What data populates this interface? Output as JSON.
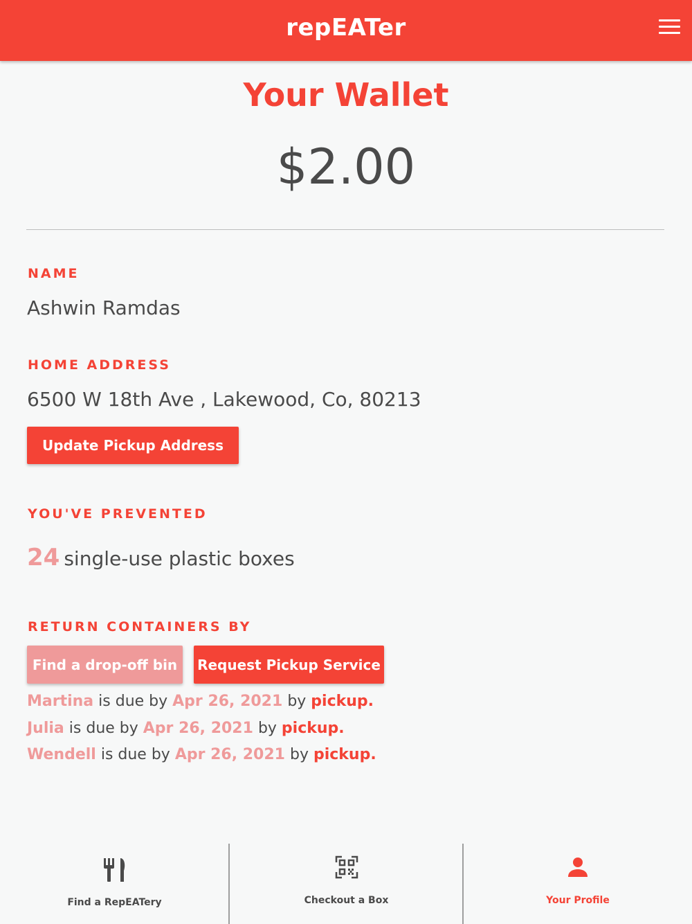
{
  "header": {
    "brand": "repEATer",
    "menu_icon": "hamburger-menu-icon",
    "color": "#f44336"
  },
  "wallet": {
    "title": "Your Wallet",
    "amount": "$2.00"
  },
  "profile": {
    "name_label": "NAME",
    "name": "Ashwin Ramdas",
    "address_label": "HOME ADDRESS",
    "address": "6500 W 18th Ave , Lakewood, Co, 80213",
    "update_button": "Update Pickup Address"
  },
  "prevented": {
    "label": "YOU'VE PREVENTED",
    "count": "24",
    "text": "single-use plastic boxes"
  },
  "return": {
    "label": "RETURN CONTAINERS BY",
    "dropoff_button": "Find a drop-off bin",
    "pickup_button": "Request Pickup Service",
    "due_text": "is due by",
    "by_text": "by",
    "items": [
      {
        "name": "Martina",
        "date": "Apr 26, 2021",
        "method": "pickup."
      },
      {
        "name": "Julia",
        "date": "Apr 26, 2021",
        "method": "pickup."
      },
      {
        "name": "Wendell",
        "date": "Apr 26, 2021",
        "method": "pickup."
      }
    ]
  },
  "bottom_nav": {
    "items": [
      {
        "label": "Find a RepEATery",
        "icon": "fork-knife-icon",
        "active": false
      },
      {
        "label": "Checkout a Box",
        "icon": "qr-code-icon",
        "active": false
      },
      {
        "label": "Your Profile",
        "icon": "person-icon",
        "active": true
      }
    ]
  },
  "colors": {
    "accent": "#f44336",
    "accent_light": "#ef9a9a",
    "text": "#4a4a4a",
    "background": "#f7f8f8"
  }
}
